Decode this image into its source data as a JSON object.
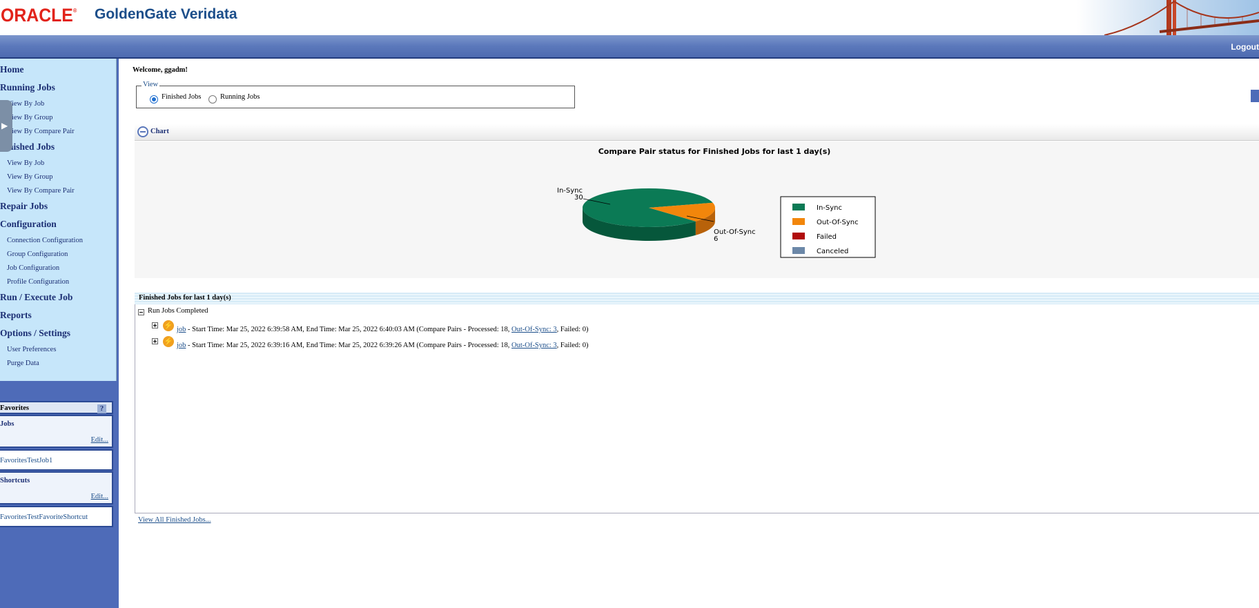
{
  "header": {
    "oracle_logo": "ORACLE",
    "product_name": "GoldenGate Veridata",
    "logout": "Logout"
  },
  "nav": {
    "home": "Home",
    "running_jobs": "Running Jobs",
    "running_items": [
      "View By Job",
      "View By Group",
      "View By Compare Pair"
    ],
    "finished_jobs": "Finished Jobs",
    "finished_items": [
      "View By Job",
      "View By Group",
      "View By Compare Pair"
    ],
    "repair_jobs": "Repair Jobs",
    "configuration": "Configuration",
    "configuration_items": [
      "Connection Configuration",
      "Group Configuration",
      "Job Configuration",
      "Profile Configuration"
    ],
    "run_execute": "Run / Execute Job",
    "reports": "Reports",
    "options": "Options / Settings",
    "options_items": [
      "User Preferences",
      "Purge Data"
    ]
  },
  "favorites": {
    "title": "Favorites",
    "help": "?",
    "jobs_label": "Jobs",
    "jobs_edit": "Edit...",
    "jobs_item": "FavoritesTestJob1",
    "shortcuts_label": "Shortcuts",
    "shortcuts_edit": "Edit...",
    "shortcuts_item": "FavoritesTestFavoriteShortcut"
  },
  "main": {
    "welcome": "Welcome, ggadm!",
    "view_legend": "View",
    "radio_finished": "Finished Jobs",
    "radio_running": "Running Jobs",
    "selected_view": "Finished Jobs",
    "chart_section": "Chart",
    "jobs_section_title": "Finished Jobs for last 1 day(s)",
    "tree_root": "Run Jobs Completed",
    "jobs": [
      {
        "link": "job",
        "text": " - Start Time: Mar 25, 2022 6:39:58 AM, End Time: Mar 25, 2022 6:40:03 AM (Compare Pairs - Processed: 18, ",
        "oos_link": "Out-Of-Sync: 3",
        "tail": ", Failed: 0)"
      },
      {
        "link": "job",
        "text": " - Start Time: Mar 25, 2022 6:39:16 AM, End Time: Mar 25, 2022 6:39:26 AM (Compare Pairs - Processed: 18, ",
        "oos_link": "Out-Of-Sync: 3",
        "tail": ", Failed: 0)"
      }
    ],
    "view_all": "View All Finished Jobs..."
  },
  "colors": {
    "in_sync": "#0b7a55",
    "out_of_sync": "#f2860b",
    "failed": "#b00c0c",
    "canceled": "#6c88a8"
  },
  "chart_data": {
    "type": "pie",
    "title": "Compare Pair status for Finished Jobs for last 1 day(s)",
    "categories": [
      "In-Sync",
      "Out-Of-Sync",
      "Failed",
      "Canceled"
    ],
    "values": [
      30,
      6,
      0,
      0
    ],
    "legend": [
      "In-Sync",
      "Out-Of-Sync",
      "Failed",
      "Canceled"
    ],
    "legend_position": "right"
  }
}
